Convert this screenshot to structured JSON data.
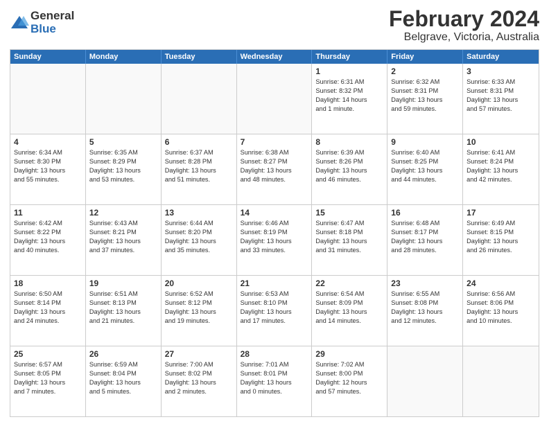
{
  "logo": {
    "general": "General",
    "blue": "Blue"
  },
  "title": "February 2024",
  "subtitle": "Belgrave, Victoria, Australia",
  "days": [
    "Sunday",
    "Monday",
    "Tuesday",
    "Wednesday",
    "Thursday",
    "Friday",
    "Saturday"
  ],
  "weeks": [
    [
      {
        "day": "",
        "text": ""
      },
      {
        "day": "",
        "text": ""
      },
      {
        "day": "",
        "text": ""
      },
      {
        "day": "",
        "text": ""
      },
      {
        "day": "1",
        "text": "Sunrise: 6:31 AM\nSunset: 8:32 PM\nDaylight: 14 hours\nand 1 minute."
      },
      {
        "day": "2",
        "text": "Sunrise: 6:32 AM\nSunset: 8:31 PM\nDaylight: 13 hours\nand 59 minutes."
      },
      {
        "day": "3",
        "text": "Sunrise: 6:33 AM\nSunset: 8:31 PM\nDaylight: 13 hours\nand 57 minutes."
      }
    ],
    [
      {
        "day": "4",
        "text": "Sunrise: 6:34 AM\nSunset: 8:30 PM\nDaylight: 13 hours\nand 55 minutes."
      },
      {
        "day": "5",
        "text": "Sunrise: 6:35 AM\nSunset: 8:29 PM\nDaylight: 13 hours\nand 53 minutes."
      },
      {
        "day": "6",
        "text": "Sunrise: 6:37 AM\nSunset: 8:28 PM\nDaylight: 13 hours\nand 51 minutes."
      },
      {
        "day": "7",
        "text": "Sunrise: 6:38 AM\nSunset: 8:27 PM\nDaylight: 13 hours\nand 48 minutes."
      },
      {
        "day": "8",
        "text": "Sunrise: 6:39 AM\nSunset: 8:26 PM\nDaylight: 13 hours\nand 46 minutes."
      },
      {
        "day": "9",
        "text": "Sunrise: 6:40 AM\nSunset: 8:25 PM\nDaylight: 13 hours\nand 44 minutes."
      },
      {
        "day": "10",
        "text": "Sunrise: 6:41 AM\nSunset: 8:24 PM\nDaylight: 13 hours\nand 42 minutes."
      }
    ],
    [
      {
        "day": "11",
        "text": "Sunrise: 6:42 AM\nSunset: 8:22 PM\nDaylight: 13 hours\nand 40 minutes."
      },
      {
        "day": "12",
        "text": "Sunrise: 6:43 AM\nSunset: 8:21 PM\nDaylight: 13 hours\nand 37 minutes."
      },
      {
        "day": "13",
        "text": "Sunrise: 6:44 AM\nSunset: 8:20 PM\nDaylight: 13 hours\nand 35 minutes."
      },
      {
        "day": "14",
        "text": "Sunrise: 6:46 AM\nSunset: 8:19 PM\nDaylight: 13 hours\nand 33 minutes."
      },
      {
        "day": "15",
        "text": "Sunrise: 6:47 AM\nSunset: 8:18 PM\nDaylight: 13 hours\nand 31 minutes."
      },
      {
        "day": "16",
        "text": "Sunrise: 6:48 AM\nSunset: 8:17 PM\nDaylight: 13 hours\nand 28 minutes."
      },
      {
        "day": "17",
        "text": "Sunrise: 6:49 AM\nSunset: 8:15 PM\nDaylight: 13 hours\nand 26 minutes."
      }
    ],
    [
      {
        "day": "18",
        "text": "Sunrise: 6:50 AM\nSunset: 8:14 PM\nDaylight: 13 hours\nand 24 minutes."
      },
      {
        "day": "19",
        "text": "Sunrise: 6:51 AM\nSunset: 8:13 PM\nDaylight: 13 hours\nand 21 minutes."
      },
      {
        "day": "20",
        "text": "Sunrise: 6:52 AM\nSunset: 8:12 PM\nDaylight: 13 hours\nand 19 minutes."
      },
      {
        "day": "21",
        "text": "Sunrise: 6:53 AM\nSunset: 8:10 PM\nDaylight: 13 hours\nand 17 minutes."
      },
      {
        "day": "22",
        "text": "Sunrise: 6:54 AM\nSunset: 8:09 PM\nDaylight: 13 hours\nand 14 minutes."
      },
      {
        "day": "23",
        "text": "Sunrise: 6:55 AM\nSunset: 8:08 PM\nDaylight: 13 hours\nand 12 minutes."
      },
      {
        "day": "24",
        "text": "Sunrise: 6:56 AM\nSunset: 8:06 PM\nDaylight: 13 hours\nand 10 minutes."
      }
    ],
    [
      {
        "day": "25",
        "text": "Sunrise: 6:57 AM\nSunset: 8:05 PM\nDaylight: 13 hours\nand 7 minutes."
      },
      {
        "day": "26",
        "text": "Sunrise: 6:59 AM\nSunset: 8:04 PM\nDaylight: 13 hours\nand 5 minutes."
      },
      {
        "day": "27",
        "text": "Sunrise: 7:00 AM\nSunset: 8:02 PM\nDaylight: 13 hours\nand 2 minutes."
      },
      {
        "day": "28",
        "text": "Sunrise: 7:01 AM\nSunset: 8:01 PM\nDaylight: 13 hours\nand 0 minutes."
      },
      {
        "day": "29",
        "text": "Sunrise: 7:02 AM\nSunset: 8:00 PM\nDaylight: 12 hours\nand 57 minutes."
      },
      {
        "day": "",
        "text": ""
      },
      {
        "day": "",
        "text": ""
      }
    ]
  ]
}
